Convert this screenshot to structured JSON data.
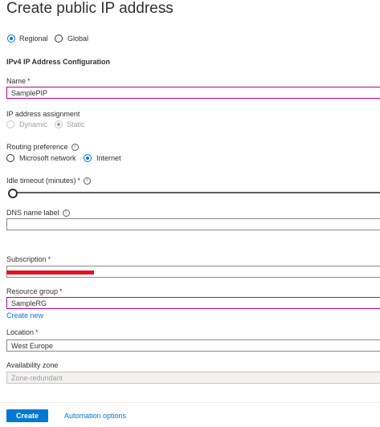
{
  "page": {
    "title": "Create public IP address",
    "more": "···"
  },
  "version": {
    "regional": "Regional",
    "global": "Global",
    "selected": "Regional"
  },
  "config_title": "IPv4 IP Address Configuration",
  "name": {
    "label": "Name",
    "required": "*",
    "value": "SamplePIP"
  },
  "assignment": {
    "label": "IP address assignment",
    "dynamic": "Dynamic",
    "static": "Static",
    "selected": "Static"
  },
  "routing": {
    "label": "Routing preference",
    "microsoft": "Microsoft network",
    "internet": "Internet",
    "selected": "Internet"
  },
  "idle": {
    "label": "Idle timeout (minutes)",
    "required": "*"
  },
  "dns": {
    "label": "DNS name label",
    "value": ""
  },
  "subscription": {
    "label": "Subscription",
    "required": "*"
  },
  "resource_group": {
    "label": "Resource group",
    "required": "*",
    "value": "SampleRG",
    "create_new": "Create new"
  },
  "location": {
    "label": "Location",
    "required": "*",
    "value": "West Europe"
  },
  "availability": {
    "label": "Availability zone",
    "value": "Zone-redundant"
  },
  "footer": {
    "create": "Create",
    "automation": "Automation options"
  },
  "colors": {
    "accent": "#0078d4",
    "focus": "#b4009e",
    "required": "#a4262c",
    "redaction": "#e81123"
  },
  "icons": {
    "info": "info-icon"
  }
}
